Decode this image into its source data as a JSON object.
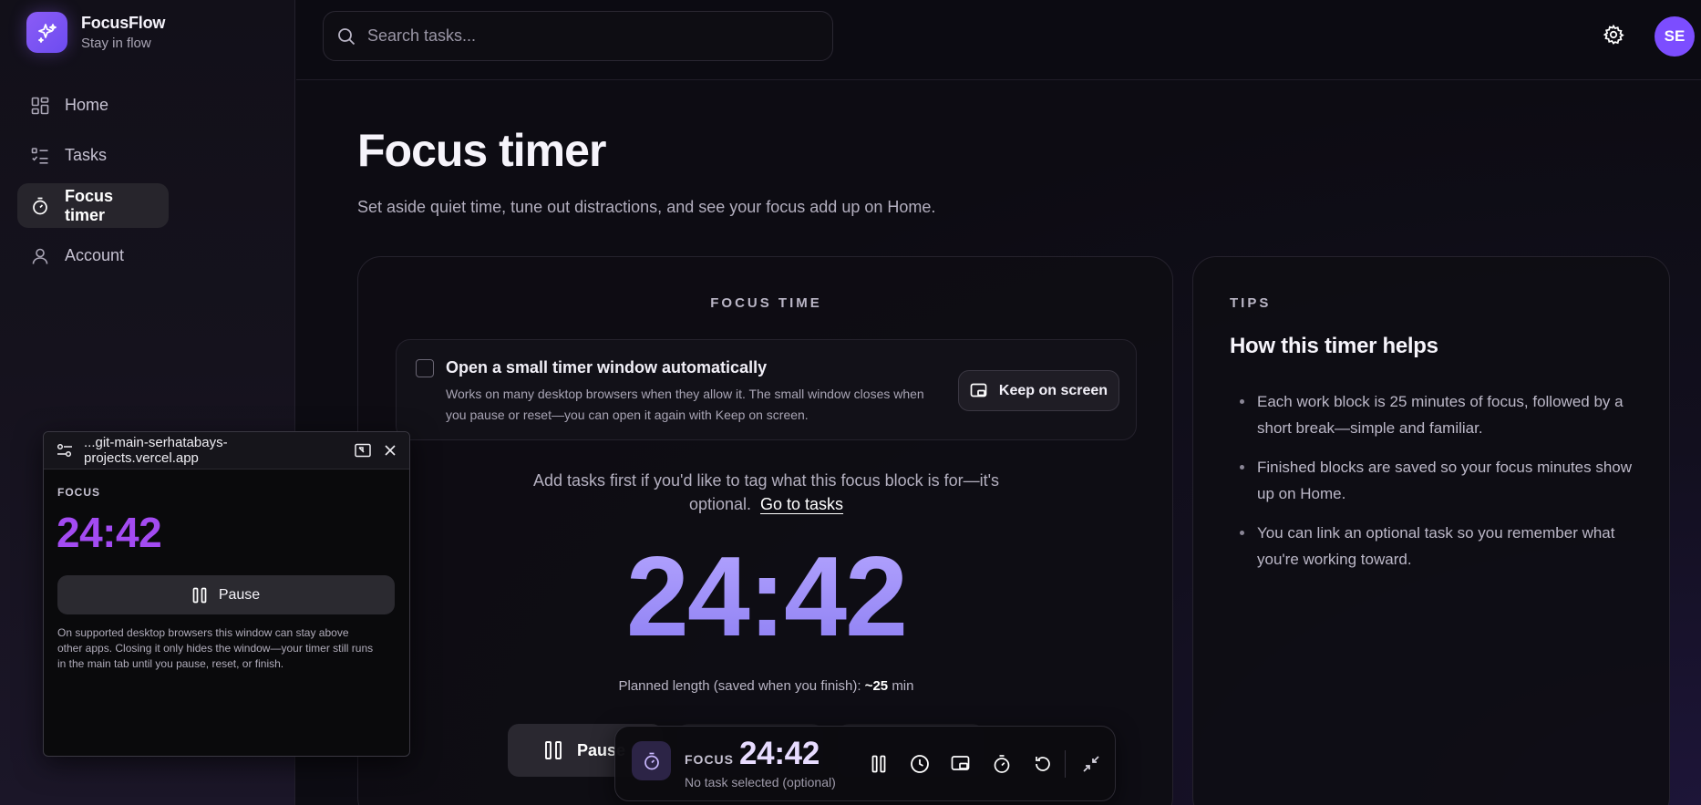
{
  "brand": {
    "name": "FocusFlow",
    "tagline": "Stay in flow"
  },
  "sidebar": {
    "items": [
      {
        "label": "Home",
        "icon": "grid-icon",
        "active": false
      },
      {
        "label": "Tasks",
        "icon": "checklist-icon",
        "active": false
      },
      {
        "label": "Focus timer",
        "icon": "stopwatch-icon",
        "active": true
      },
      {
        "label": "Account",
        "icon": "user-icon",
        "active": false
      }
    ]
  },
  "header": {
    "search_placeholder": "Search tasks...",
    "avatar_initials": "SE"
  },
  "page": {
    "title": "Focus timer",
    "subtitle": "Set aside quiet time, tune out distractions, and see your focus add up on Home."
  },
  "focus_card": {
    "label": "FOCUS TIME",
    "auto_window": {
      "checked": false,
      "title": "Open a small timer window automatically",
      "description": "Works on many desktop browsers when they allow it. The small window closes when you pause or reset—you can open it again with Keep on screen.",
      "keep_button": "Keep on screen"
    },
    "hint_text": "Add tasks first if you'd like to tag what this focus block is for—it's optional.",
    "hint_link": "Go to tasks",
    "time": "24:42",
    "planned_prefix": "Planned length (saved when you finish):",
    "planned_value": "~25",
    "planned_unit": "min",
    "pause_button": "Pause"
  },
  "tips": {
    "label": "TIPS",
    "title": "How this timer helps",
    "items": [
      "Each work block is 25 minutes of focus, followed by a short break—simple and familiar.",
      "Finished blocks are saved so your focus minutes show up on Home.",
      "You can link an optional task so you remember what you're working toward."
    ]
  },
  "mini_window": {
    "url": "...git-main-serhatabays-projects.vercel.app",
    "label": "FOCUS",
    "time": "24:42",
    "pause_button": "Pause",
    "note": "On supported desktop browsers this window can stay above other apps. Closing it only hides the window—your timer still runs in the main tab until you pause, reset, or finish."
  },
  "dock": {
    "label": "FOCUS",
    "time": "24:42",
    "task": "No task selected (optional)",
    "icons": [
      "pause-icon",
      "clock-icon",
      "picture-in-picture-icon",
      "stopwatch-icon",
      "reset-icon",
      "collapse-icon"
    ]
  },
  "colors": {
    "accent": "#7c4dff",
    "timer_gradient_top": "#b5a6ff",
    "mini_timer": "#a34bf2"
  }
}
